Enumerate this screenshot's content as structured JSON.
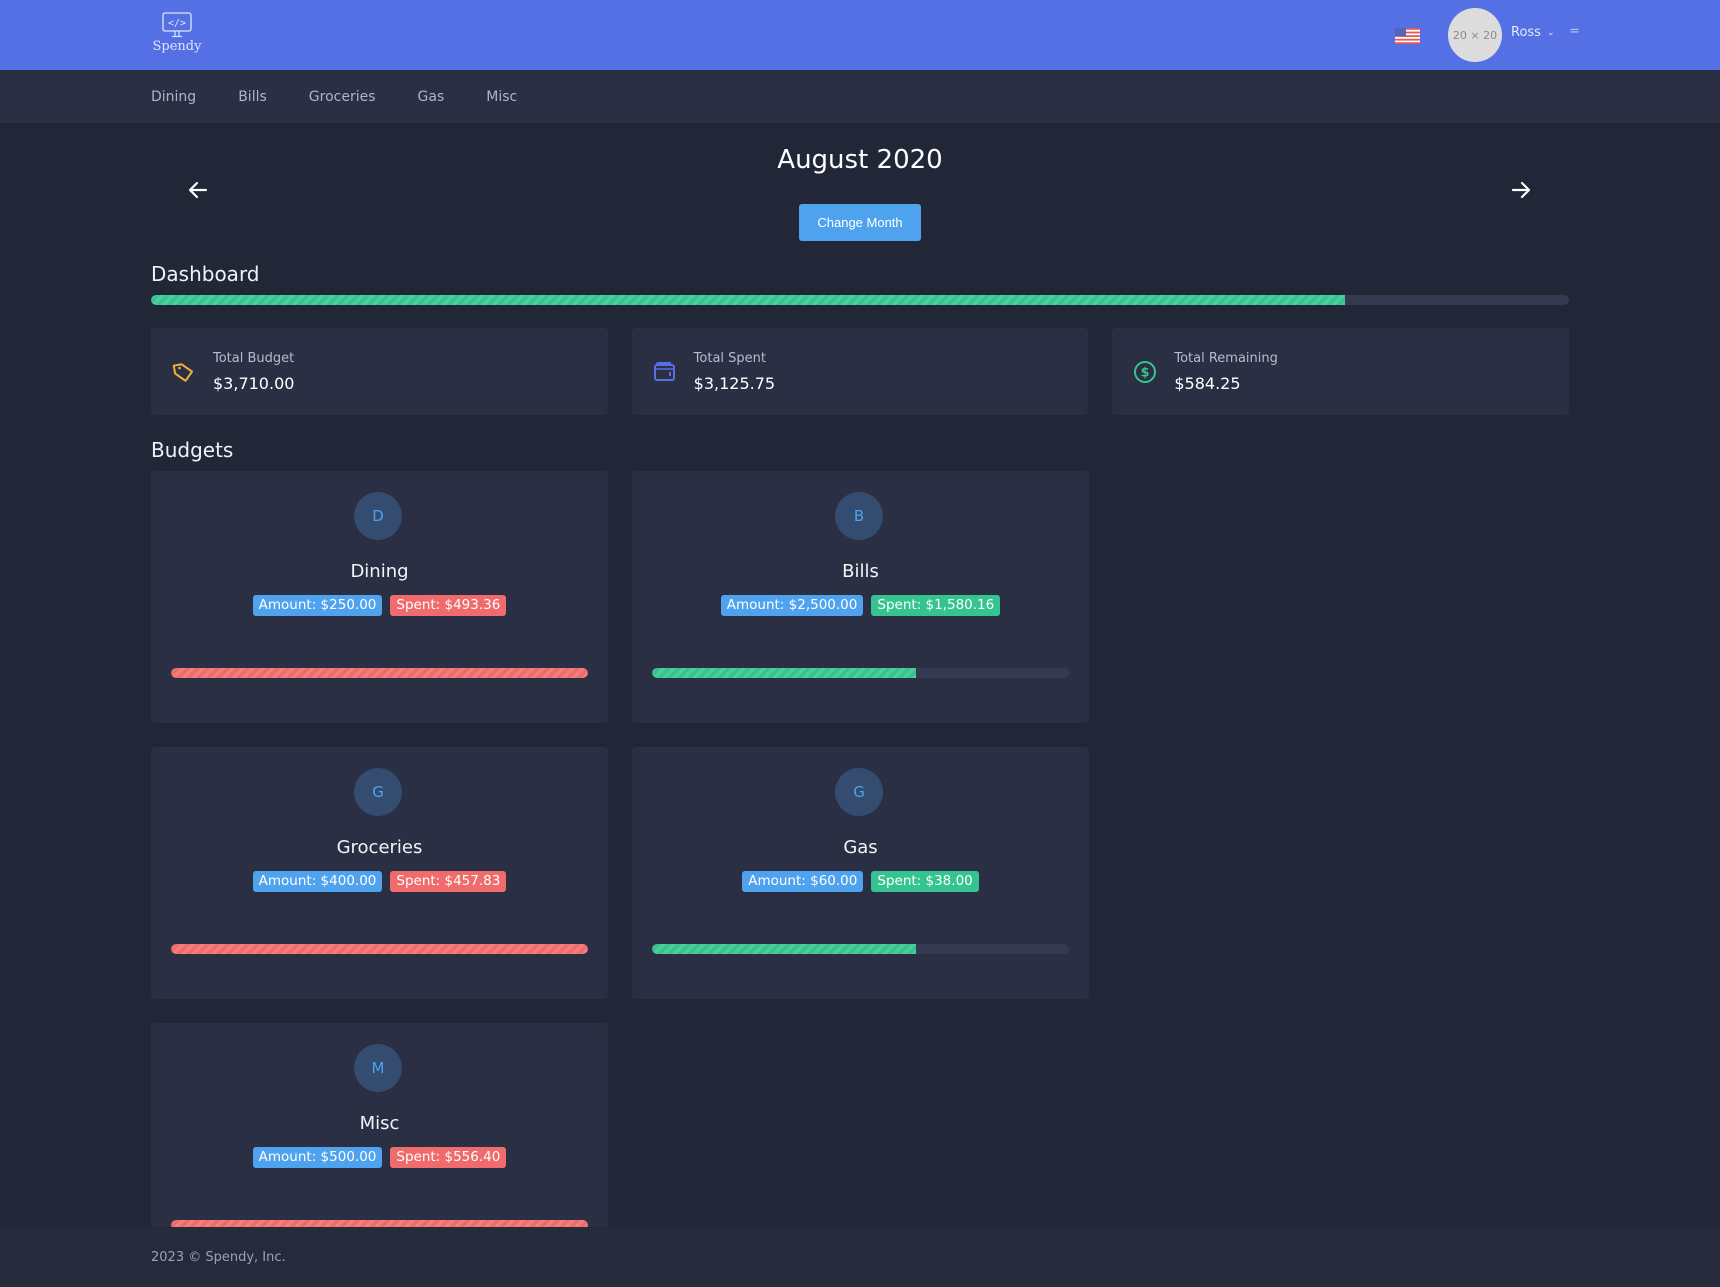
{
  "app": {
    "name": "Spendy"
  },
  "header": {
    "user_name": "Ross",
    "avatar_placeholder": "20 × 20",
    "menu_glyph": "="
  },
  "subnav": {
    "items": [
      {
        "label": "Dining"
      },
      {
        "label": "Bills"
      },
      {
        "label": "Groceries"
      },
      {
        "label": "Gas"
      },
      {
        "label": "Misc"
      }
    ]
  },
  "month": {
    "title": "August 2020",
    "change_label": "Change Month"
  },
  "dashboard": {
    "title": "Dashboard",
    "progress_percent": 84.2,
    "stats": [
      {
        "label": "Total Budget",
        "value": "$3,710.00",
        "icon": "tag-icon",
        "color": "#f2b134"
      },
      {
        "label": "Total Spent",
        "value": "$3,125.75",
        "icon": "wallet-icon",
        "color": "#5470e4"
      },
      {
        "label": "Total Remaining",
        "value": "$584.25",
        "icon": "dollar-circle-icon",
        "color": "#35c48f"
      }
    ]
  },
  "budgets": {
    "title": "Budgets",
    "items": [
      {
        "initial": "D",
        "name": "Dining",
        "amount": "Amount: $250.00",
        "spent": "Spent: $493.36",
        "status": "red",
        "progress_percent": 100
      },
      {
        "initial": "B",
        "name": "Bills",
        "amount": "Amount: $2,500.00",
        "spent": "Spent: $1,580.16",
        "status": "green",
        "progress_percent": 63.2
      },
      {
        "initial": "G",
        "name": "Groceries",
        "amount": "Amount: $400.00",
        "spent": "Spent: $457.83",
        "status": "red",
        "progress_percent": 100
      },
      {
        "initial": "G",
        "name": "Gas",
        "amount": "Amount: $60.00",
        "spent": "Spent: $38.00",
        "status": "green",
        "progress_percent": 63.3
      },
      {
        "initial": "M",
        "name": "Misc",
        "amount": "Amount: $500.00",
        "spent": "Spent: $556.40",
        "status": "red",
        "progress_percent": 100
      }
    ]
  },
  "colors": {
    "header": "#5470e4",
    "primary": "#4fa3ee",
    "success": "#35c48f",
    "danger": "#f06b6b",
    "warning": "#f2b134"
  },
  "footer": {
    "text": "2023 © Spendy, Inc."
  }
}
